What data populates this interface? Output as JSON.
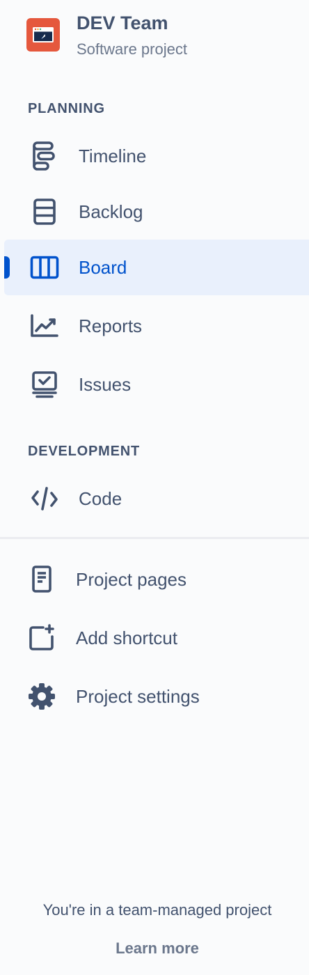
{
  "project": {
    "name": "DEV Team",
    "type": "Software project",
    "avatar_color": "#e5583d"
  },
  "sections": {
    "planning": "PLANNING",
    "development": "DEVELOPMENT"
  },
  "nav": {
    "timeline": {
      "label": "Timeline",
      "icon": "timeline-icon"
    },
    "backlog": {
      "label": "Backlog",
      "icon": "backlog-icon"
    },
    "board": {
      "label": "Board",
      "icon": "board-icon",
      "active": true
    },
    "reports": {
      "label": "Reports",
      "icon": "reports-icon"
    },
    "issues": {
      "label": "Issues",
      "icon": "issues-icon"
    },
    "code": {
      "label": "Code",
      "icon": "code-icon"
    },
    "project_pages": {
      "label": "Project pages",
      "icon": "page-icon"
    },
    "add_shortcut": {
      "label": "Add shortcut",
      "icon": "add-shortcut-icon"
    },
    "project_settings": {
      "label": "Project settings",
      "icon": "gear-icon"
    }
  },
  "footer": {
    "text": "You're in a team-managed project",
    "link": "Learn more"
  },
  "colors": {
    "text": "#42526e",
    "subtle": "#6b778c",
    "accent": "#0052cc",
    "active_bg": "#e9f0fc",
    "background": "#fafbfc"
  }
}
